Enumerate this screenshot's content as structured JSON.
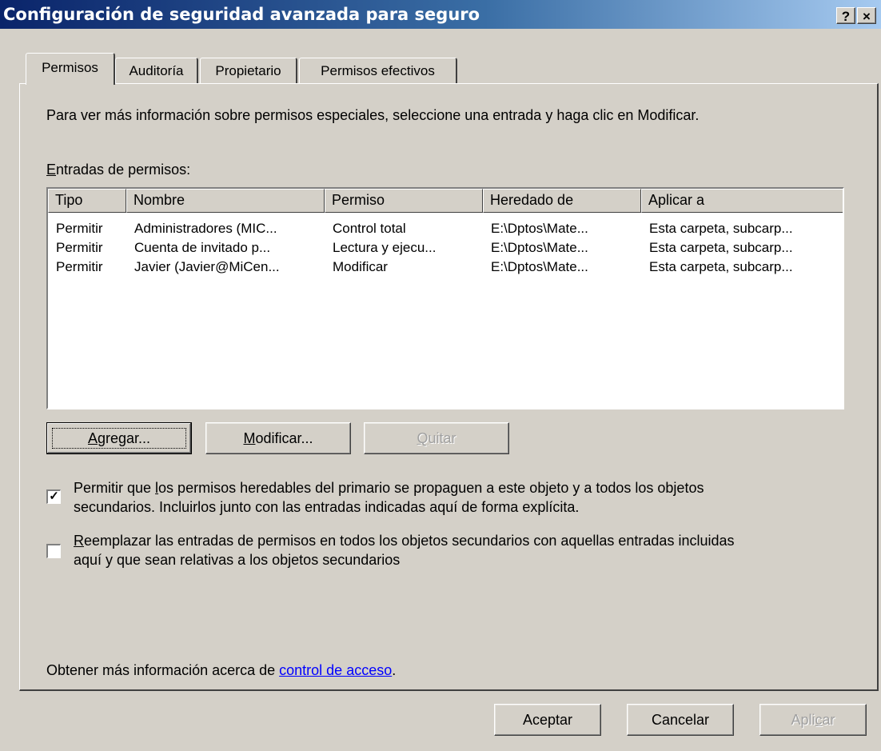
{
  "window": {
    "title": "Configuración de seguridad avanzada para seguro",
    "help_glyph": "?",
    "close_glyph": "×"
  },
  "tabs": [
    {
      "label": "Permisos"
    },
    {
      "label": "Auditoría"
    },
    {
      "label": "Propietario"
    },
    {
      "label": "Permisos efectivos"
    }
  ],
  "permissions": {
    "info_text": "Para ver más información sobre permisos especiales, seleccione una entrada y haga clic en Modificar.",
    "entries_label_accel": "E",
    "entries_label_rest": "ntradas de permisos:",
    "columns": [
      "Tipo",
      "Nombre",
      "Permiso",
      "Heredado de",
      "Aplicar a"
    ],
    "rows": [
      [
        "Permitir",
        "Administradores (MIC...",
        "Control total",
        "E:\\Dptos\\Mate...",
        "Esta carpeta, subcarp..."
      ],
      [
        "Permitir",
        "Cuenta de invitado p...",
        "Lectura y ejecu...",
        "E:\\Dptos\\Mate...",
        "Esta carpeta, subcarp..."
      ],
      [
        "Permitir",
        "Javier (Javier@MiCen...",
        "Modificar",
        "E:\\Dptos\\Mate...",
        "Esta carpeta, subcarp..."
      ]
    ],
    "buttons": {
      "add": {
        "accel": "A",
        "rest": "gregar..."
      },
      "modify": {
        "accel": "M",
        "rest": "odificar..."
      },
      "remove": {
        "accel": "Q",
        "rest": "uitar"
      }
    },
    "inherit_checkbox": {
      "checked": true,
      "mark": "✓",
      "line1_a": "Permitir que ",
      "line1_accel": "l",
      "line1_b": "os permisos heredables del primario se propaguen a este objeto y a todos los objetos",
      "line2": "secundarios. Incluirlos junto con las entradas indicadas aquí de forma explícita."
    },
    "replace_checkbox": {
      "checked": false,
      "line1_accel": "R",
      "line1_rest": "eemplazar las entradas de permisos en todos los objetos secundarios con aquellas entradas incluidas",
      "line2": "aquí y que sean relativas a los objetos secundarios"
    },
    "footer_text": "Obtener más información acerca de ",
    "footer_link": "control de acceso",
    "footer_end": "."
  },
  "dialog_buttons": {
    "ok": "Aceptar",
    "cancel": "Cancelar",
    "apply_a": "Apli",
    "apply_accel": "c",
    "apply_b": "ar"
  }
}
